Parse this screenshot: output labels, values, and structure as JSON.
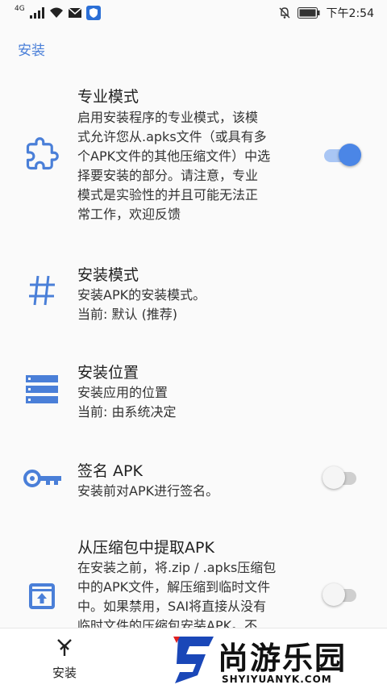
{
  "status_bar": {
    "network": "4G",
    "time": "下午2:54"
  },
  "section_title": "安装",
  "preferences": [
    {
      "title": "专业模式",
      "summary": "启用安装程序的专业模式，该模\n式允许您从.apks文件（或具有多\n个APK文件的其他压缩文件）中选\n择要安装的部分。请注意，专业\n模式是实验性的并且可能无法正\n常工作，欢迎反馈",
      "icon": "puzzle-icon",
      "switch": "on"
    },
    {
      "title": "安装模式",
      "summary": "安装APK的安装模式。\n当前: 默认 (推荐)",
      "icon": "hash-icon"
    },
    {
      "title": "安装位置",
      "summary": "安装应用的位置\n当前: 由系统决定",
      "icon": "storage-icon"
    },
    {
      "title": "签名 APK",
      "summary": "安装前对APK进行签名。",
      "icon": "key-icon",
      "switch": "off"
    },
    {
      "title": "从压缩包中提取APK",
      "summary": "在安装之前，将.zip / .apks压缩包\n中的APK文件，解压缩到临时文件\n中。如果禁用，SAI将直接从没有\n临时文件的压缩包安装APK。不",
      "icon": "archive-upload-icon",
      "switch": "off"
    }
  ],
  "bottom_nav": {
    "item_label": "安装",
    "icon": "merge-arrow-icon"
  },
  "watermark": {
    "text": "尚游乐园",
    "sub": "SHYIYUANYK.COM"
  },
  "colors": {
    "accent": "#4b86e6",
    "icon_blue": "#4a7fd8"
  }
}
